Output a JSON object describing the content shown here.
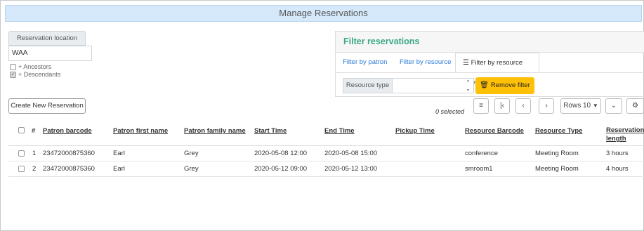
{
  "window": {
    "title": "Manage Reservations"
  },
  "location": {
    "label": "Reservation location",
    "value": "WAA",
    "options": [
      {
        "label": "+ Ancestors",
        "checked": false
      },
      {
        "label": "+ Descendants",
        "checked": true
      }
    ]
  },
  "create_button": {
    "label": "Create New Reservation"
  },
  "filter": {
    "title": "Filter reservations",
    "tabs": [
      {
        "label": "Filter by patron"
      },
      {
        "label": "Filter by resource"
      },
      {
        "label": "Filter by resource type",
        "active": true
      }
    ],
    "resource_type": {
      "label": "Resource type",
      "value": ""
    },
    "remove_label": "Remove filter"
  },
  "toolbar": {
    "selected_text": "0 selected",
    "rows_label": "Rows 10",
    "icons": [
      "filter-list-icon",
      "first-page-icon",
      "prev-page-icon",
      "next-page-icon",
      "caret-down-icon",
      "gear-icon"
    ]
  },
  "table": {
    "columns": [
      "#",
      "Patron barcode",
      "Patron first name",
      "Patron family name",
      "Start Time",
      "End Time",
      "Pickup Time",
      "Resource Barcode",
      "Resource Type",
      "Reservation length"
    ],
    "rows": [
      [
        "1",
        "23472000875360",
        "Earl",
        "Grey",
        "2020-05-08 12:00",
        "2020-05-08 15:00",
        "",
        "conference",
        "Meeting Room",
        "3 hours"
      ],
      [
        "2",
        "23472000875360",
        "Earl",
        "Grey",
        "2020-05-12 09:00",
        "2020-05-12 13:00",
        "",
        "smroom1",
        "Meeting Room",
        "4 hours"
      ]
    ]
  },
  "colors": {
    "title_bg": "#d6e9fb",
    "accent_green": "#3aa887",
    "link_blue": "#2c7bd6",
    "warning": "#ffc107"
  }
}
